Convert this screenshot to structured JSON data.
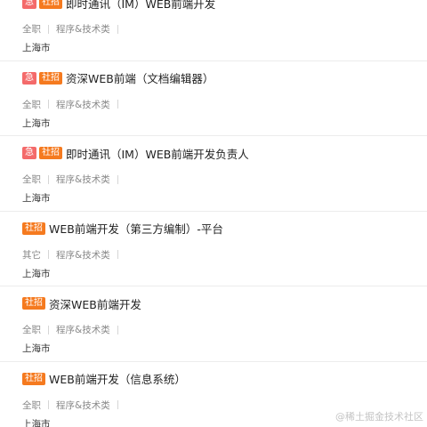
{
  "jobs": [
    {
      "urgent": "急",
      "type": "社招",
      "title": "即时通讯（IM）WEB前端开发",
      "category": "全职",
      "field": "程序&技术类",
      "location": "上海市"
    },
    {
      "urgent": "急",
      "type": "社招",
      "title": "资深WEB前端（文档编辑器）",
      "category": "全职",
      "field": "程序&技术类",
      "location": "上海市"
    },
    {
      "urgent": "急",
      "type": "社招",
      "title": "即时通讯（IM）WEB前端开发负责人",
      "category": "全职",
      "field": "程序&技术类",
      "location": "上海市"
    },
    {
      "urgent": "",
      "type": "社招",
      "title": "WEB前端开发（第三方编制）-平台",
      "category": "其它",
      "field": "程序&技术类",
      "location": "上海市"
    },
    {
      "urgent": "",
      "type": "社招",
      "title": "资深WEB前端开发",
      "category": "全职",
      "field": "程序&技术类",
      "location": "上海市"
    },
    {
      "urgent": "",
      "type": "社招",
      "title": "WEB前端开发（信息系统）",
      "category": "全职",
      "field": "程序&技术类",
      "location": "上海市"
    }
  ],
  "watermark": "@稀土掘金技术社区",
  "colors": {
    "urgent_tag": "#f46a6a",
    "social_tag": "#f57a1f"
  }
}
